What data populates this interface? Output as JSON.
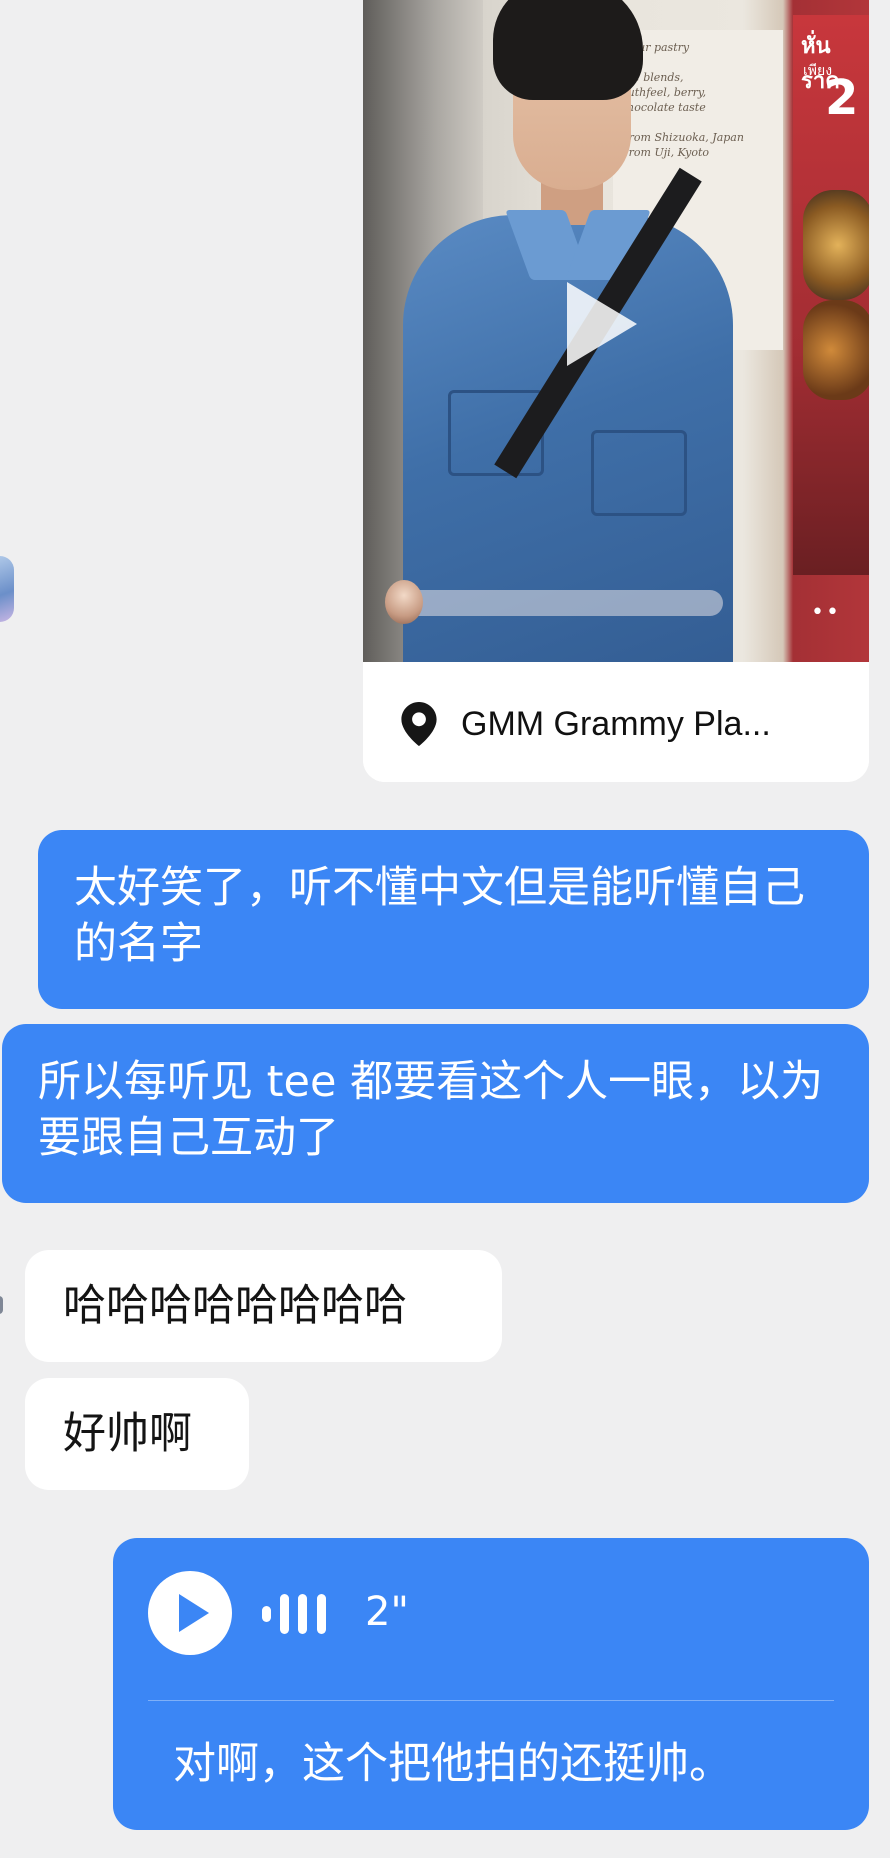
{
  "video_card": {
    "menu_text": "...our pastry\n\nase blends,\nouthfeel, berry,\nchocolate taste\n\nFrom Shizuoka, Japan\nFrom Uji, Kyoto",
    "poster_line1": "หั่นราค",
    "poster_line2": "เพียง",
    "poster_big": "2",
    "more_dots": "••",
    "location": "GMM Grammy Pla..."
  },
  "messages": [
    {
      "id": "m1",
      "direction": "outgoing",
      "text": "太好笑了，听不懂中文但是能听懂自己的名字"
    },
    {
      "id": "m2",
      "direction": "outgoing",
      "text": "所以每听见 tee 都要看这个人一眼，以为要跟自己互动了"
    },
    {
      "id": "m3",
      "direction": "incoming",
      "text": "哈哈哈哈哈哈哈哈"
    },
    {
      "id": "m4",
      "direction": "incoming",
      "text": "好帅啊"
    }
  ],
  "voice_message": {
    "duration": "2\"",
    "transcript": "对啊，这个把他拍的还挺帅。"
  },
  "colors": {
    "background": "#efeff0",
    "outgoing_bubble": "#3b86f5",
    "incoming_bubble": "#ffffff"
  }
}
